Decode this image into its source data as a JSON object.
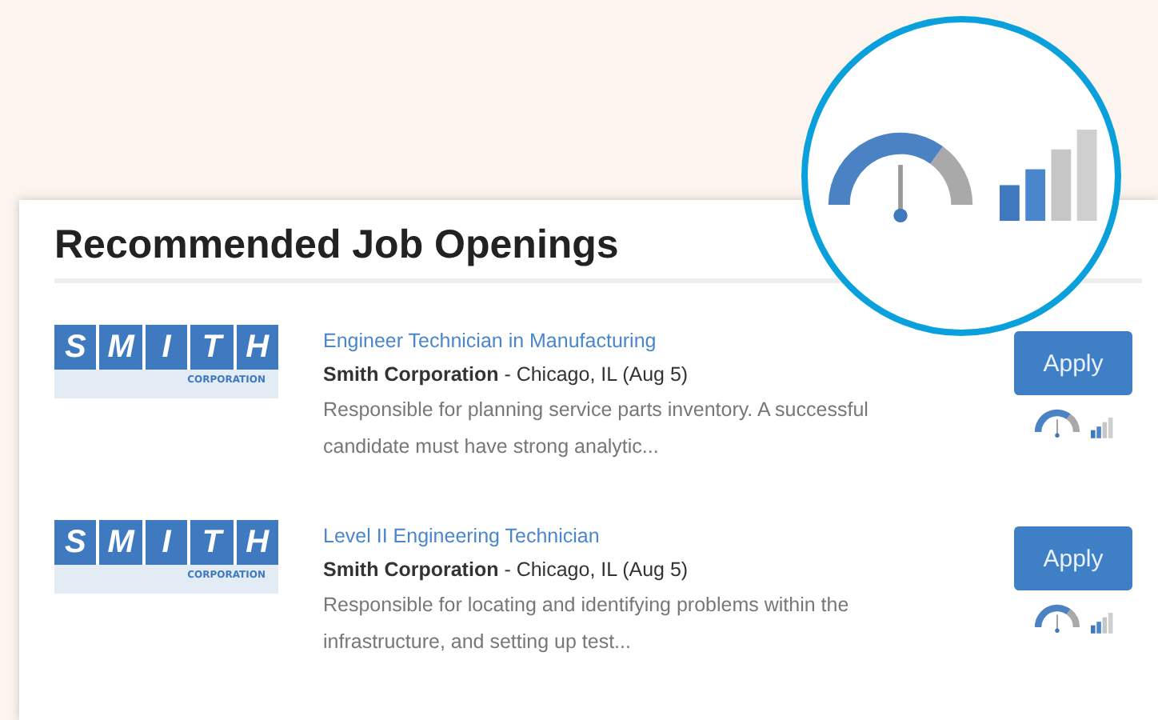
{
  "title": "Recommended Job Openings",
  "jobs": [
    {
      "logo_letters": [
        "S",
        "M",
        "I",
        "T",
        "H"
      ],
      "logo_sub": "CORPORATION",
      "title": "Engineer Technician in Manufacturing",
      "company": "Smith Corporation",
      "location": " - Chicago, IL (Aug 5)",
      "description": "Responsible for planning service parts inventory. A successful candidate must have strong analytic...",
      "button": "Apply"
    },
    {
      "logo_letters": [
        "S",
        "M",
        "I",
        "T",
        "H"
      ],
      "logo_sub": "CORPORATION",
      "title": "Level II Engineering Technician",
      "company": "Smith Corporation",
      "location": " - Chicago, IL (Aug 5)",
      "description": "Responsible for locating and identifying problems within the infrastructure, and setting up test...",
      "button": "Apply"
    }
  ]
}
